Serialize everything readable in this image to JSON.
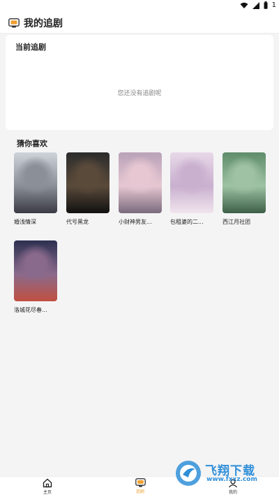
{
  "status_bar": {
    "battery_text": "1"
  },
  "header": {
    "title": "我的追剧"
  },
  "current": {
    "section_title": "当前追剧",
    "empty_text": "您还没有追剧呢"
  },
  "recommend": {
    "section_title": "猜你喜欢",
    "items": [
      {
        "title": "婚浅情深",
        "colors": [
          "#cfd4da",
          "#8b8f98",
          "#3a3a44"
        ]
      },
      {
        "title": "代号黑龙",
        "colors": [
          "#2c2c2c",
          "#5a4a3a",
          "#111111"
        ]
      },
      {
        "title": "小财神男友...",
        "colors": [
          "#b9a2b8",
          "#e6c7d2",
          "#7a6a7c"
        ]
      },
      {
        "title": "包租婆的二...",
        "colors": [
          "#e8d8e8",
          "#c9b0cf",
          "#f1e4ee"
        ]
      },
      {
        "title": "西江月社团",
        "colors": [
          "#5e8c6a",
          "#9ec2a3",
          "#3c5f47"
        ]
      },
      {
        "title": "洛城花尽春...",
        "colors": [
          "#2c3050",
          "#8a6a8c",
          "#c05040"
        ]
      }
    ]
  },
  "bottom_nav": {
    "items": [
      {
        "label": "主页",
        "icon": "home-icon",
        "active": false
      },
      {
        "label": "追剧",
        "icon": "tv-icon",
        "active": true
      },
      {
        "label": "我的",
        "icon": "profile-icon",
        "active": false
      }
    ]
  },
  "watermark": {
    "text": "飞翔下载",
    "url": "www.fxxz.com"
  },
  "colors": {
    "accent": "#f0a030",
    "background": "#f4f4f5",
    "watermark": "#2f8fd8"
  }
}
